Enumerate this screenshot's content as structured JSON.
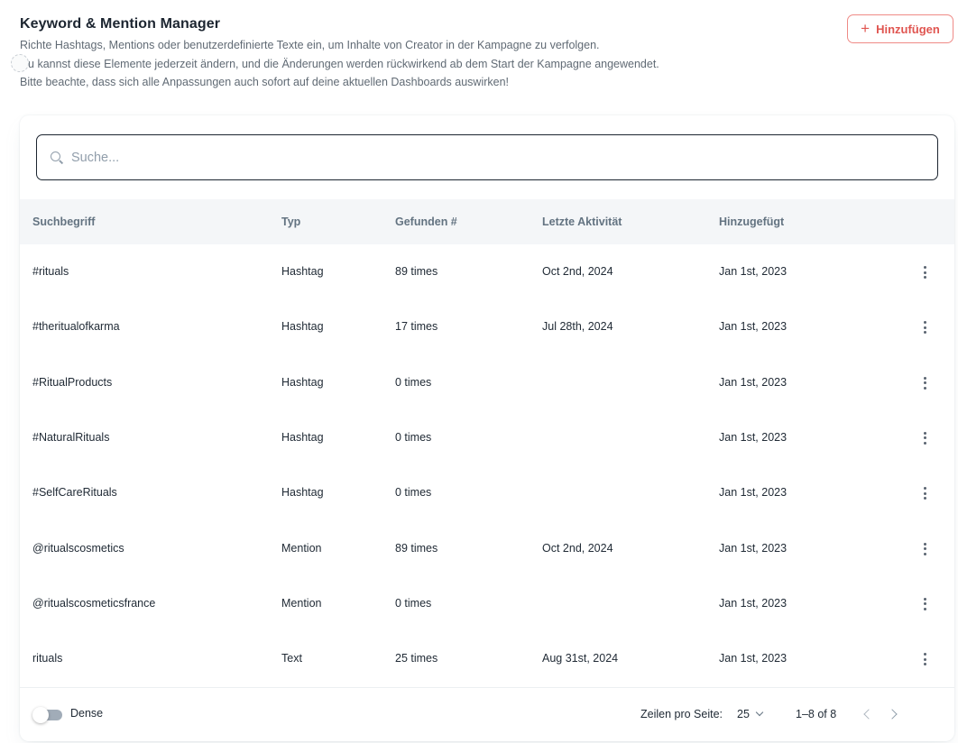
{
  "header": {
    "title": "Keyword & Mention Manager",
    "description_lines": [
      "Richte Hashtags, Mentions oder benutzerdefinierte Texte ein, um Inhalte von Creator in der Kampagne zu verfolgen.",
      "Du kannst diese Elemente jederzeit ändern, und die Änderungen werden rückwirkend ab dem Start der Kampagne angewendet.",
      "Bitte beachte, dass sich alle Anpassungen auch sofort auf deine aktuellen Dashboards auswirken!"
    ],
    "add_button": {
      "label": "Hinzufügen",
      "icon": "plus-icon"
    }
  },
  "search": {
    "placeholder": "Suche...",
    "value": "",
    "icon": "search-icon"
  },
  "table": {
    "columns": [
      "Suchbegriff",
      "Typ",
      "Gefunden #",
      "Letzte Aktivität",
      "Hinzugefügt"
    ],
    "rows": [
      {
        "term": "#rituals",
        "type": "Hashtag",
        "found": "89 times",
        "last_activity": "Oct 2nd, 2024",
        "added": "Jan 1st, 2023"
      },
      {
        "term": "#theritualofkarma",
        "type": "Hashtag",
        "found": "17 times",
        "last_activity": "Jul 28th, 2024",
        "added": "Jan 1st, 2023"
      },
      {
        "term": "#RitualProducts",
        "type": "Hashtag",
        "found": "0 times",
        "last_activity": "",
        "added": "Jan 1st, 2023"
      },
      {
        "term": "#NaturalRituals",
        "type": "Hashtag",
        "found": "0 times",
        "last_activity": "",
        "added": "Jan 1st, 2023"
      },
      {
        "term": "#SelfCareRituals",
        "type": "Hashtag",
        "found": "0 times",
        "last_activity": "",
        "added": "Jan 1st, 2023"
      },
      {
        "term": "@ritualscosmetics",
        "type": "Mention",
        "found": "89 times",
        "last_activity": "Oct 2nd, 2024",
        "added": "Jan 1st, 2023"
      },
      {
        "term": "@ritualscosmeticsfrance",
        "type": "Mention",
        "found": "0 times",
        "last_activity": "",
        "added": "Jan 1st, 2023"
      },
      {
        "term": "rituals",
        "type": "Text",
        "found": "25 times",
        "last_activity": "Aug 31st, 2024",
        "added": "Jan 1st, 2023"
      }
    ]
  },
  "footer": {
    "dense_label": "Dense",
    "dense_enabled": false,
    "rows_per_page_label": "Zeilen pro Seite:",
    "rows_per_page_value": "25",
    "range_label": "1–8 of 8"
  },
  "colors": {
    "accent": "#e05550",
    "accent_border": "#ef8a86",
    "header_bg": "#f4f6f8",
    "text": "#212b36",
    "muted": "#637381"
  }
}
